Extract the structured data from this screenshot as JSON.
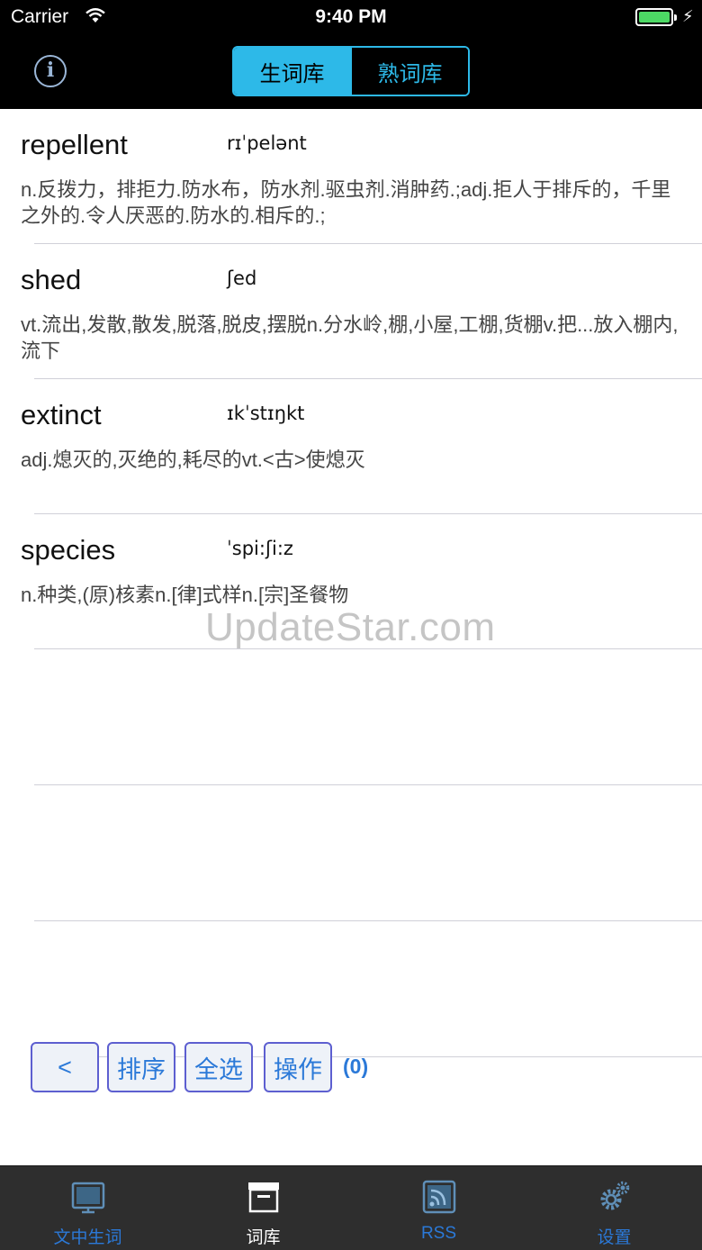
{
  "status_bar": {
    "carrier": "Carrier",
    "time": "9:40 PM"
  },
  "nav": {
    "info_icon": "i",
    "segments": [
      {
        "label": "生词库",
        "selected": true
      },
      {
        "label": "熟词库",
        "selected": false
      }
    ]
  },
  "words": [
    {
      "word": "repellent",
      "phonetic": "rɪˈpelənt",
      "meaning": "n.反拨力，排拒力.防水布，防水剂.驱虫剂.消肿药.;adj.拒人于排斥的，千里之外的.令人厌恶的.防水的.相斥的.;"
    },
    {
      "word": "shed",
      "phonetic": "ʃed",
      "meaning": "vt.流出,发散,散发,脱落,脱皮,摆脱n.分水岭,棚,小屋,工棚,货棚v.把...放入棚内,流下"
    },
    {
      "word": "extinct",
      "phonetic": "ɪkˈstɪŋkt",
      "meaning": "adj.熄灭的,灭绝的,耗尽的vt.<古>使熄灭"
    },
    {
      "word": "species",
      "phonetic": "ˈspi:ʃi:z",
      "meaning": "n.种类,(原)核素n.[律]式样n.[宗]圣餐物"
    }
  ],
  "watermark": "UpdateStar.com",
  "actions": {
    "back": "<",
    "sort": "排序",
    "select_all": "全选",
    "operate": "操作",
    "count": "(0)"
  },
  "tabs": [
    {
      "label": "文中生词",
      "icon": "screen-icon",
      "color": "#2b79d8"
    },
    {
      "label": "词库",
      "icon": "archive-box-icon",
      "color": "#ffffff"
    },
    {
      "label": "RSS",
      "icon": "rss-icon",
      "color": "#2b79d8"
    },
    {
      "label": "设置",
      "icon": "gear-icon",
      "color": "#2b79d8"
    }
  ]
}
